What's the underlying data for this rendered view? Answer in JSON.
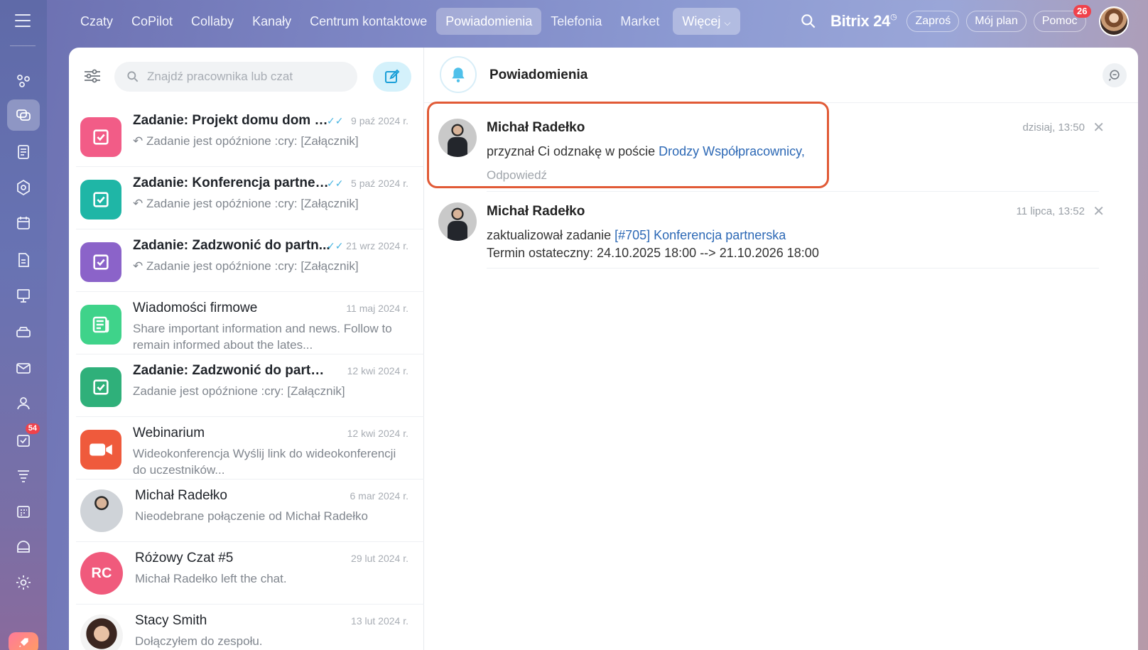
{
  "topnav": {
    "tabs": [
      "Czaty",
      "CoPilot",
      "Collaby",
      "Kanały",
      "Centrum kontaktowe",
      "Powiadomienia",
      "Telefonia",
      "Market"
    ],
    "active_tab": "Powiadomienia",
    "more_label": "Więcej"
  },
  "topright": {
    "brand": "Bitrix 24",
    "invite_label": "Zaproś",
    "plan_label": "Mój plan",
    "help_label": "Pomoc",
    "help_badge": "26"
  },
  "rail": {
    "tasks_badge": "54"
  },
  "search": {
    "placeholder": "Znajdź pracownika lub czat"
  },
  "chats": [
    {
      "title": "Zadanie: Projekt domu dom p...",
      "date": "9 paź 2024 r.",
      "sub": "↶ Zadanie jest opóźnione :cry: [Załącznik]",
      "color": "#f25c87",
      "read": "✓✓"
    },
    {
      "title": "Zadanie: Konferencja partners...",
      "date": "5 paź 2024 r.",
      "sub": "↶ Zadanie jest opóźnione :cry: [Załącznik]",
      "color": "#1fb6a6",
      "read": "✓✓"
    },
    {
      "title": "Zadanie: Zadzwonić do partn...",
      "date": "21 wrz 2024 r.",
      "sub": "↶ Zadanie jest opóźnione :cry: [Załącznik]",
      "color": "#8b63c9",
      "read": "✓✓"
    },
    {
      "title": "Wiadomości firmowe",
      "date": "11 maj 2024 r.",
      "sub": "Share important information and news. Follow to remain informed about the lates...",
      "color": "#3fd38a"
    },
    {
      "title": "Zadanie: Zadzwonić do partner...",
      "date": "12 kwi 2024 r.",
      "sub": "Zadanie jest opóźnione :cry: [Załącznik]",
      "color": "#2fb07a"
    },
    {
      "title": "Webinarium",
      "date": "12 kwi 2024 r.",
      "sub": "Wideokonferencja Wyślij link do wideokonferencji do uczestników...",
      "color": "#ef5a3c"
    },
    {
      "title": "Michał Radełko",
      "date": "6 mar 2024 r.",
      "sub": "Nieodebrane połączenie od Michał Radełko",
      "color": "#cfcfcf"
    },
    {
      "title": "Różowy Czat #5",
      "date": "29 lut 2024 r.",
      "sub": "Michał Radełko left the chat.",
      "color": "#f05a7c",
      "initials": "RC"
    },
    {
      "title": "Stacy Smith",
      "date": "13 lut 2024 r.",
      "sub": "Dołączyłem do zespołu.",
      "color": "#7a5a4a"
    }
  ],
  "right": {
    "title": "Powiadomienia"
  },
  "notifications": [
    {
      "name": "Michał Radełko",
      "time": "dzisiaj, 13:50",
      "text_before": "przyznał Ci odznakę w poście ",
      "link": "Drodzy Współpracownicy,",
      "reply": "Odpowiedź"
    },
    {
      "name": "Michał Radełko",
      "time": "11 lipca, 13:52",
      "text_before": "zaktualizował zadanie ",
      "link": "[#705] Konferencja partnerska",
      "line2": "Termin ostateczny: 24.10.2025 18:00 --> 21.10.2026 18:00"
    }
  ]
}
